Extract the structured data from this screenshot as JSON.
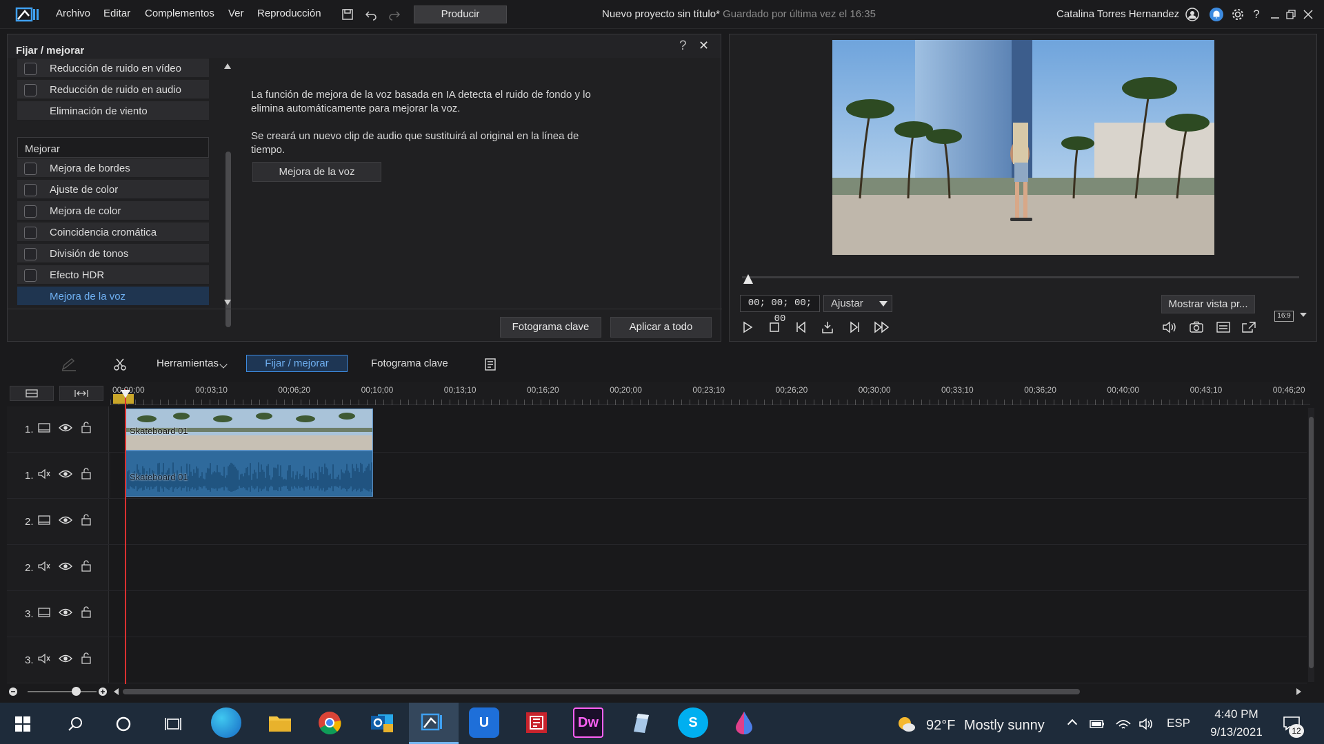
{
  "titlebar": {
    "menu": [
      "Archivo",
      "Editar",
      "Complementos",
      "Ver",
      "Reproducción"
    ],
    "produce_label": "Producir",
    "project_title": "Nuevo proyecto sin título*",
    "saved_text": "Guardado por última vez el 16:35",
    "user_name": "Catalina Torres Hernandez"
  },
  "fix_panel": {
    "title": "Fijar / mejorar",
    "help": "?",
    "close": "✕",
    "fix_items": [
      "Reducción de ruido en vídeo",
      "Reducción de ruido en audio",
      "Eliminación de viento"
    ],
    "enhance_group": "Mejorar",
    "enhance_items": [
      "Mejora de bordes",
      "Ajuste de color",
      "Mejora de color",
      "Coincidencia cromática",
      "División de tonos",
      "Efecto HDR",
      "Mejora de la voz"
    ],
    "description_1a": "La función de mejora de la voz basada en IA detecta el ruido de fondo y lo",
    "description_1b": "elimina automáticamente para mejorar la voz.",
    "description_2a": "Se creará un nuevo clip de audio que sustituirá al original en la línea de",
    "description_2b": "tiempo.",
    "voice_button": "Mejora de la voz",
    "keyframe_button": "Fotograma clave",
    "apply_all_button": "Aplicar a todo"
  },
  "preview": {
    "timecode": "00; 00; 00; 00",
    "fit_option": "Ajustar",
    "show_preview": "Mostrar vista pr...",
    "aspect": "16:9"
  },
  "toolbar": {
    "tools": "Herramientas",
    "fix": "Fijar / mejorar",
    "keyframe": "Fotograma clave"
  },
  "timeline": {
    "ruler": [
      "00;00;00",
      "00;03;10",
      "00;06;20",
      "00;10;00",
      "00;13;10",
      "00;16;20",
      "00;20;00",
      "00;23;10",
      "00;26;20",
      "00;30;00",
      "00;33;10",
      "00;36;20",
      "00;40;00",
      "00;43;10",
      "00;46;20"
    ],
    "tracks": [
      "1.",
      "1.",
      "2.",
      "2.",
      "3.",
      "3."
    ],
    "clip_video": "Skateboard 01",
    "clip_audio": "Skateboard 01"
  },
  "taskbar": {
    "temperature": "92°F",
    "weather": "Mostly sunny",
    "language": "ESP",
    "time": "4:40 PM",
    "date": "9/13/2021",
    "notifications": "12",
    "apps": {
      "dw": "Dw",
      "u": "U",
      "s": "S"
    }
  },
  "colors": {
    "accent": "#3d8be0",
    "selected_text": "#6fb0f2",
    "playhead": "#d93030"
  }
}
